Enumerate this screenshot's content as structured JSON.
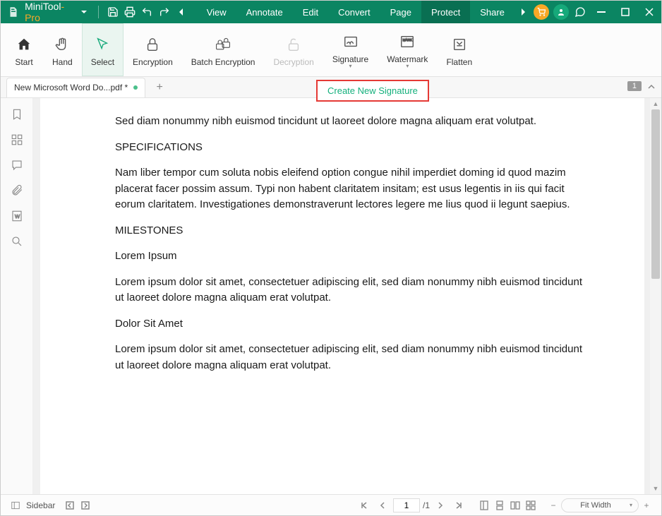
{
  "titlebar": {
    "brand_main": "MiniTool",
    "brand_suffix": "-Pro",
    "menus": [
      "View",
      "Annotate",
      "Edit",
      "Convert",
      "Page",
      "Protect",
      "Share"
    ],
    "active_menu_index": 5
  },
  "ribbon": {
    "items": [
      {
        "label": "Start",
        "icon": "home"
      },
      {
        "label": "Hand",
        "icon": "hand"
      },
      {
        "label": "Select",
        "icon": "cursor",
        "selected": true
      },
      {
        "label": "Encryption",
        "icon": "lock"
      },
      {
        "label": "Batch Encryption",
        "icon": "lock-batch"
      },
      {
        "label": "Decryption",
        "icon": "unlock",
        "disabled": true
      },
      {
        "label": "Signature",
        "icon": "signature",
        "dropdown": true
      },
      {
        "label": "Watermark",
        "icon": "watermark",
        "dropdown": true
      },
      {
        "label": "Flatten",
        "icon": "flatten"
      }
    ]
  },
  "tabstrip": {
    "tab_label": "New Microsoft Word Do...pdf *",
    "page_badge": "1"
  },
  "callout": {
    "label": "Create New Signature"
  },
  "document": {
    "p1": "Sed diam nonummy nibh euismod tincidunt ut laoreet dolore magna aliquam erat volutpat.",
    "h1": "SPECIFICATIONS",
    "p2": "Nam liber tempor cum soluta nobis eleifend option congue nihil imperdiet doming id quod mazim placerat facer possim assum. Typi non habent claritatem insitam; est usus legentis in iis qui facit eorum claritatem. Investigationes demonstraverunt lectores legere me lius quod ii legunt saepius.",
    "h2": "MILESTONES",
    "p3": "Lorem Ipsum",
    "p4": "Lorem ipsum dolor sit amet, consectetuer adipiscing elit, sed diam nonummy nibh euismod tincidunt ut laoreet dolore magna aliquam erat volutpat.",
    "p5": "Dolor Sit Amet",
    "p6": "Lorem ipsum dolor sit amet, consectetuer adipiscing elit, sed diam nonummy nibh euismod tincidunt ut laoreet dolore magna aliquam erat volutpat."
  },
  "statusbar": {
    "sidebar_label": "Sidebar",
    "current_page": "1",
    "total_pages": "/1",
    "fit_label": "Fit Width"
  }
}
